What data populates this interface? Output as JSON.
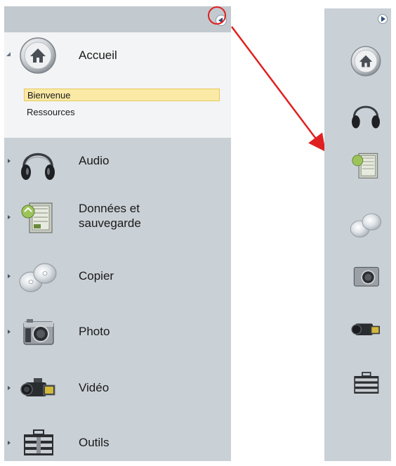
{
  "sidebar": {
    "items": [
      {
        "label": "Accueil",
        "icon": "home-icon",
        "expanded": true,
        "subitems": [
          {
            "label": "Bienvenue",
            "selected": true
          },
          {
            "label": "Ressources",
            "selected": false
          }
        ]
      },
      {
        "label": "Audio",
        "icon": "headphones-icon",
        "expanded": false
      },
      {
        "label": "Données et\nsauvegarde",
        "icon": "data-backup-icon",
        "expanded": false
      },
      {
        "label": "Copier",
        "icon": "discs-icon",
        "expanded": false
      },
      {
        "label": "Photo",
        "icon": "camera-icon",
        "expanded": false
      },
      {
        "label": "Vidéo",
        "icon": "camcorder-icon",
        "expanded": false
      },
      {
        "label": "Outils",
        "icon": "toolbox-icon",
        "expanded": false
      }
    ]
  },
  "colors": {
    "panel_bg": "#c9d0d6",
    "accueil_bg": "#f3f4f5",
    "selection_bg": "#fbe9a6",
    "annotation_red": "#e02020"
  }
}
